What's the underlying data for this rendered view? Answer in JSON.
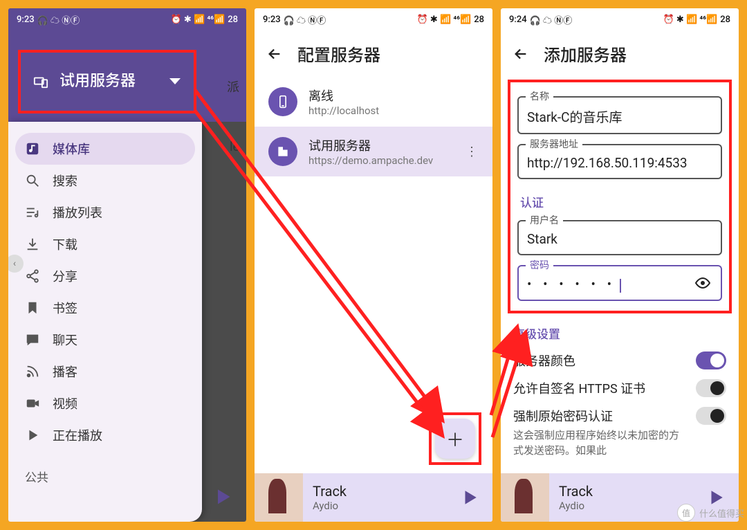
{
  "statusbar": {
    "p1_time": "9:23",
    "p2_time": "9:23",
    "p3_time": "9:24",
    "battery": "28"
  },
  "phone1": {
    "selector_label": "试用服务器",
    "menu": {
      "library": "媒体库",
      "search": "搜索",
      "playlist": "播放列表",
      "download": "下载",
      "share": "分享",
      "bookmark": "书签",
      "chat": "聊天",
      "podcast": "播客",
      "video": "视频",
      "nowplaying": "正在播放"
    },
    "section_public": "公共",
    "peek_text1": "派",
    "peek_text2": "le"
  },
  "phone2": {
    "title": "配置服务器",
    "servers": [
      {
        "name": "离线",
        "url": "http://localhost"
      },
      {
        "name": "试用服务器",
        "url": "https://demo.ampache.dev"
      }
    ],
    "nowplaying": {
      "track": "Track",
      "artist": "Aydio"
    }
  },
  "phone3": {
    "title": "添加服务器",
    "fields": {
      "name_label": "名称",
      "name_value": "Stark-C的音乐库",
      "addr_label": "服务器地址",
      "addr_value": "http://192.168.50.119:4533",
      "auth_section": "认证",
      "user_label": "用户名",
      "user_value": "Stark",
      "pass_label": "密码",
      "pass_value": "• • • • • •"
    },
    "advanced": {
      "section": "高级设置",
      "color": "服务器颜色",
      "selfsigned": "允许自签名 HTTPS 证书",
      "forcepass_title": "强制原始密码认证",
      "forcepass_desc": "这会强制应用程序始终以未加密的方式发送密码。如果此"
    },
    "nowplaying": {
      "track": "Track",
      "artist": "Aydio"
    }
  },
  "watermark": {
    "text": "什么值得买",
    "badge": "值"
  }
}
